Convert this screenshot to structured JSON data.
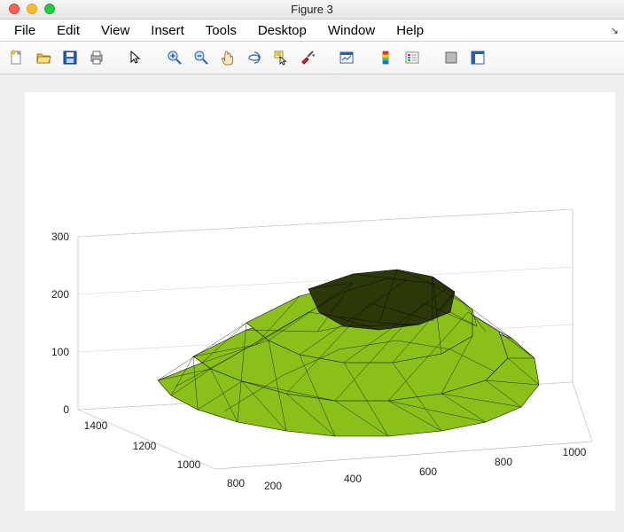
{
  "window": {
    "title": "Figure 3"
  },
  "menu": {
    "items": [
      "File",
      "Edit",
      "View",
      "Insert",
      "Tools",
      "Desktop",
      "Window",
      "Help"
    ]
  },
  "toolbar": {
    "icons": [
      {
        "name": "new-file-icon"
      },
      {
        "name": "open-folder-icon"
      },
      {
        "name": "save-icon"
      },
      {
        "name": "print-icon"
      },
      {
        "sep": true
      },
      {
        "name": "pointer-icon"
      },
      {
        "sep": true
      },
      {
        "name": "zoom-in-icon"
      },
      {
        "name": "zoom-out-icon"
      },
      {
        "name": "pan-icon"
      },
      {
        "name": "rotate3d-icon"
      },
      {
        "name": "datacursor-icon"
      },
      {
        "name": "brush-icon"
      },
      {
        "sep": true
      },
      {
        "name": "link-plot-icon"
      },
      {
        "sep": true
      },
      {
        "name": "colorbar-icon"
      },
      {
        "name": "legend-icon"
      },
      {
        "sep": true
      },
      {
        "name": "hide-plot-icon"
      },
      {
        "name": "show-plot-icon"
      }
    ]
  },
  "chart_data": {
    "type": "3d-surface-mesh",
    "title": "",
    "x_axis": {
      "range": [
        200,
        1000
      ],
      "ticks": [
        200,
        400,
        600,
        800,
        1000
      ]
    },
    "y_axis": {
      "range": [
        800,
        1400
      ],
      "ticks": [
        800,
        1000,
        1200,
        1400
      ]
    },
    "z_axis": {
      "range": [
        0,
        300
      ],
      "ticks": [
        0,
        100,
        200,
        300
      ]
    },
    "mesh_color": "#89c11a",
    "edge_color": "#000000",
    "description": "Irregular triangulated 3-D surface mesh (mound/rock shape) occupying roughly x∈[200,1000], y∈[800,1400], z∈[0,300]."
  }
}
